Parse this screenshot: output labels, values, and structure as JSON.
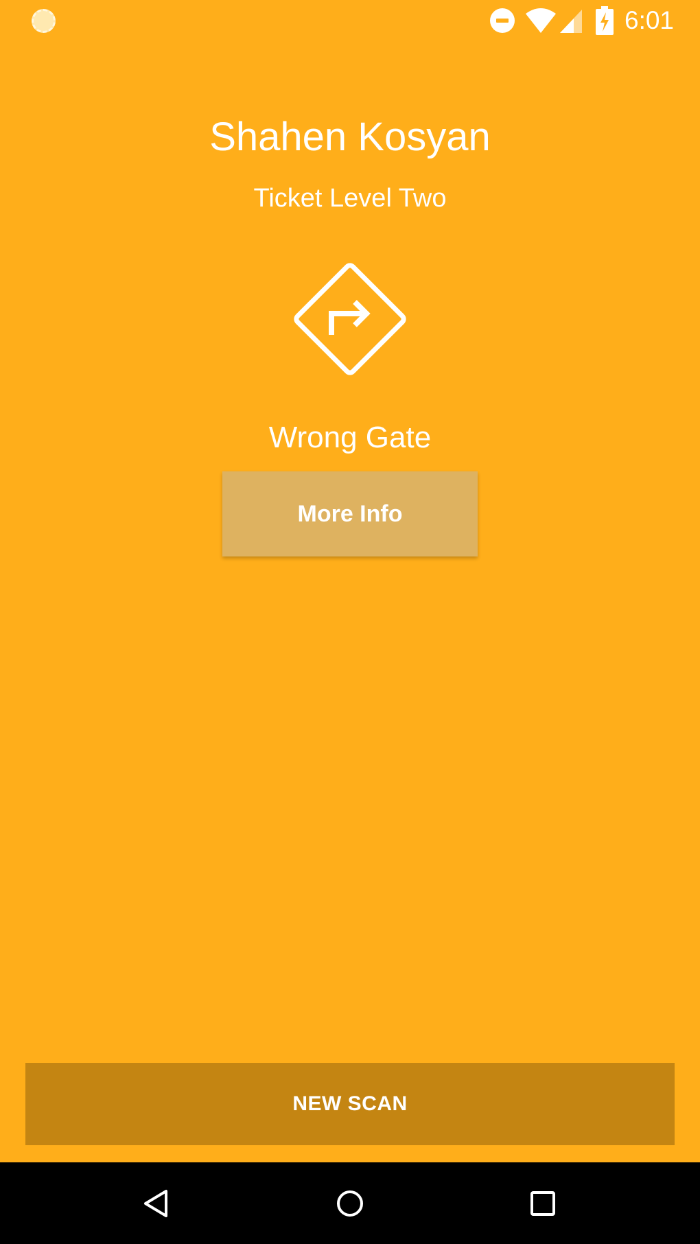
{
  "status_bar": {
    "time": "6:01",
    "icons": [
      "app-notification-icon",
      "do-not-disturb-icon",
      "wifi-icon",
      "cell-signal-icon",
      "battery-charging-icon"
    ]
  },
  "ticket": {
    "holder_name": "Shahen Kosyan",
    "level": "Ticket Level Two",
    "status_icon": "turn-right-sign-icon",
    "status": "Wrong Gate"
  },
  "actions": {
    "more_info_label": "More Info",
    "new_scan_label": "NEW SCAN"
  },
  "nav_bar": {
    "buttons": [
      "back-icon",
      "home-icon",
      "recents-icon"
    ]
  },
  "colors": {
    "background": "#FFAE1A",
    "more_info_button": "#DEB260",
    "new_scan_button": "#C48512",
    "nav_bar": "#000000",
    "foreground": "#FFFFFF"
  }
}
